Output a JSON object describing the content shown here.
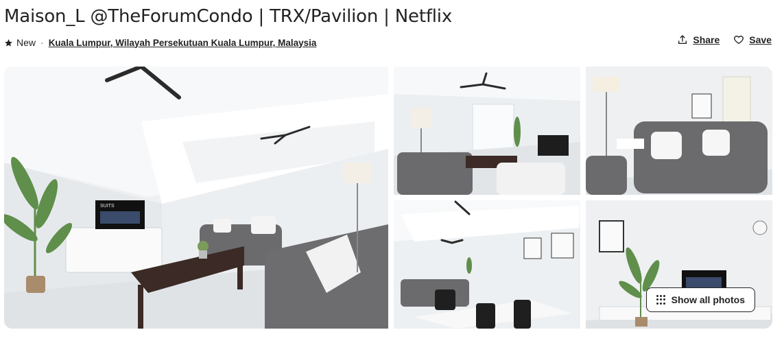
{
  "listing": {
    "title": "Maison_L @TheForumCondo | TRX/Pavilion | Netflix",
    "rating_label": "New",
    "location": "Kuala Lumpur, Wilayah Persekutuan Kuala Lumpur, Malaysia"
  },
  "actions": {
    "share_label": "Share",
    "save_label": "Save"
  },
  "gallery": {
    "show_all_label": "Show all photos",
    "tv_text": "SUITS"
  },
  "colors": {
    "text": "#222222",
    "muted": "#6a6a6a",
    "sofa": "#6b6b6d",
    "table": "#3b2a25"
  },
  "icons": [
    "star-icon",
    "share-icon",
    "heart-icon",
    "grid-dots-icon"
  ]
}
